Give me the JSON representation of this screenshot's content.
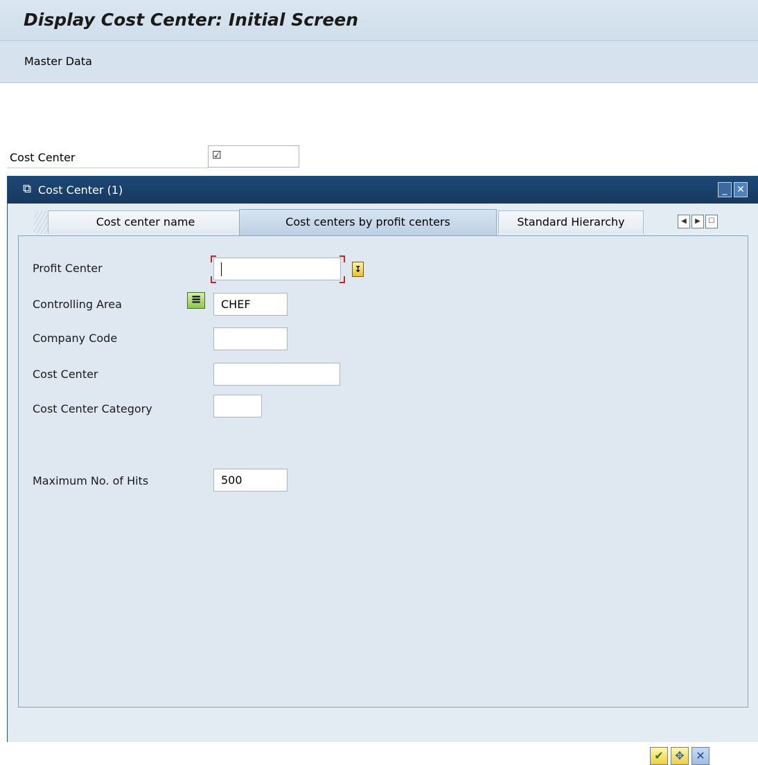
{
  "title": "Display Cost Center: Initial Screen",
  "menu": {
    "master_data": "Master Data"
  },
  "main": {
    "cost_center_label": "Cost Center"
  },
  "dialog": {
    "title": "Cost Center (1)",
    "tabs": [
      {
        "label": "Cost center name",
        "active": false
      },
      {
        "label": "Cost centers by profit centers",
        "active": true
      },
      {
        "label": "Standard Hierarchy",
        "active": false
      }
    ],
    "fields": {
      "profit_center": {
        "label": "Profit Center",
        "value": ""
      },
      "controlling_area": {
        "label": "Controlling Area",
        "value": "CHEF"
      },
      "company_code": {
        "label": "Company Code",
        "value": ""
      },
      "cost_center": {
        "label": "Cost Center",
        "value": ""
      },
      "cost_center_category": {
        "label": "Cost Center Category",
        "value": ""
      },
      "max_hits": {
        "label": "Maximum No. of Hits",
        "value": "500"
      }
    }
  },
  "colors": {
    "title_bar": "#d4e2ee",
    "dialog_header": "#1c4370",
    "panel_bg": "#dfe8f1",
    "required_marker": "#d02020"
  }
}
